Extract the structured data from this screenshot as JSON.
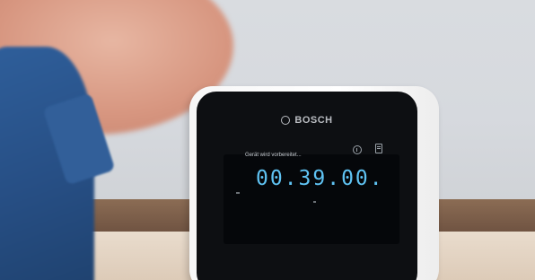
{
  "device": {
    "brand": "BOSCH",
    "screen": {
      "status_text": "Gerät wird vorbereitet...",
      "timer": "00.39.00."
    }
  },
  "icons": {
    "brand": "bosch-logo-icon",
    "info": "info-icon",
    "document": "document-icon"
  },
  "colors": {
    "timer": "#5fc3f3",
    "device_face": "#0d0f12",
    "shirt": "#2a5690"
  }
}
